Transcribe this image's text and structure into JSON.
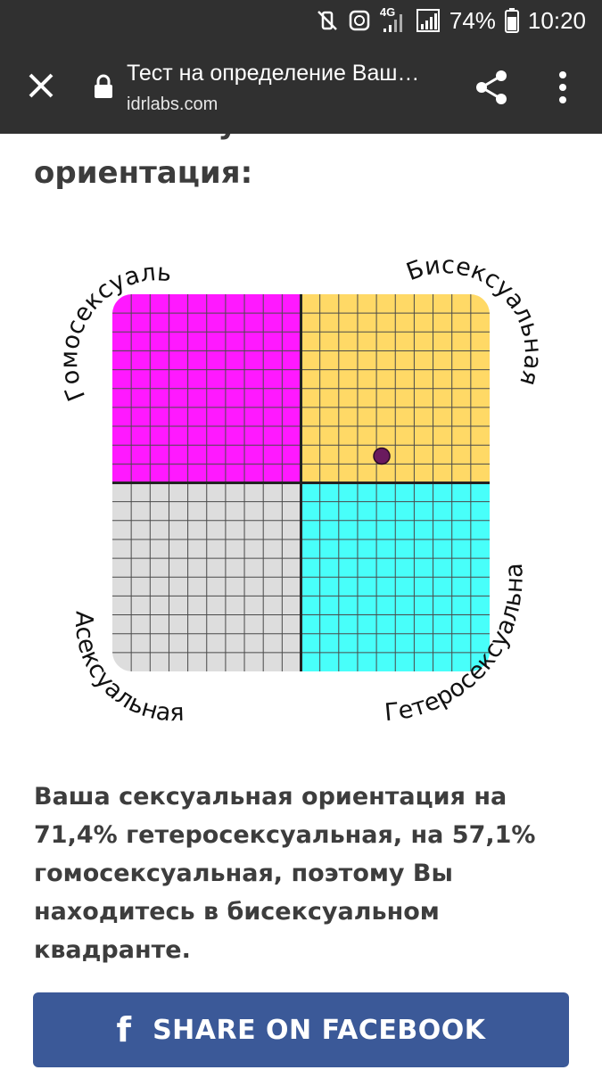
{
  "status_bar": {
    "battery_text": "74%",
    "time": "10:20",
    "network": "4G",
    "icons": [
      "mute-vibrate-icon",
      "data-saver-icon",
      "signal-4g-icon",
      "signal-icon",
      "battery-icon"
    ]
  },
  "browser": {
    "page_title": "Тест на определение Ваш…",
    "domain": "idrlabs.com",
    "icons": [
      "close-icon",
      "lock-icon",
      "share-icon",
      "more-vert-icon"
    ]
  },
  "heading": {
    "line1": "Ваша сексуальная",
    "line2": "ориентация:"
  },
  "chart_data": {
    "type": "scatter",
    "quadrants": [
      {
        "name": "Гомосексуальная",
        "color": "#ff19ff"
      },
      {
        "name": "Бисексуальная",
        "color": "#ffd966"
      },
      {
        "name": "Асексуальная",
        "color": "#dddddd"
      },
      {
        "name": "Гетеросексуальная",
        "color": "#48fffa"
      }
    ],
    "point": {
      "x": 71.4,
      "y": 57.1,
      "color": "#6a1a5e"
    },
    "xlim": [
      0,
      100
    ],
    "ylim": [
      0,
      100
    ],
    "grid": true
  },
  "result_text": "Ваша сексуальная ориентация на 71,4% гетеросексуальная, на 57,1% гомосексуальная, поэтому Вы находитесь в бисексуальном квадранте.",
  "facebook_button": {
    "label": "SHARE ON FACEBOOK",
    "icon": "facebook-icon",
    "color": "#3b5998"
  }
}
